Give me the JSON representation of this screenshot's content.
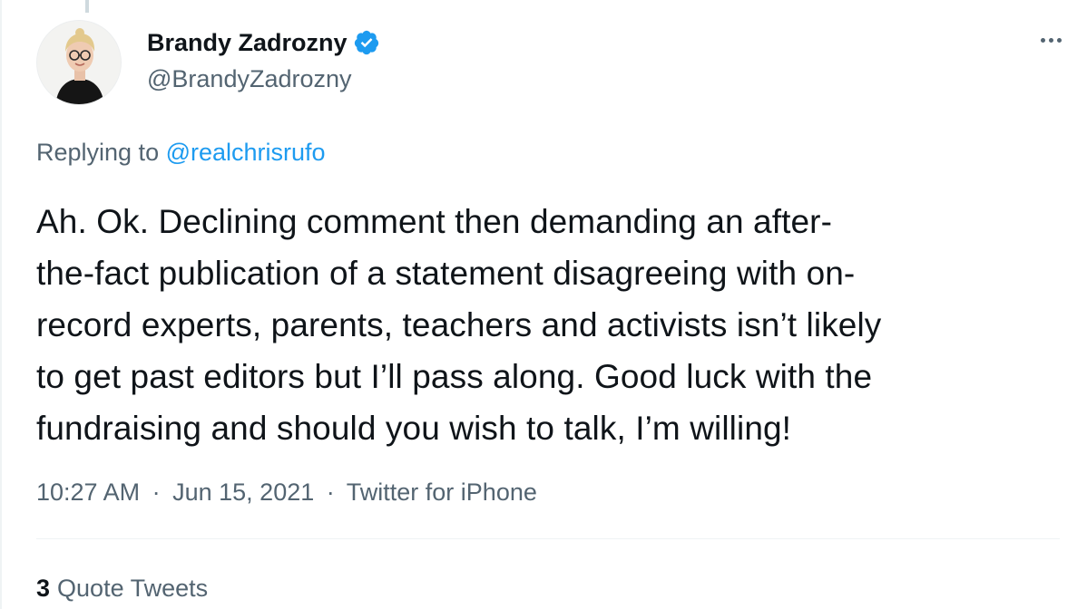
{
  "tweet": {
    "author": {
      "display_name": "Brandy Zadrozny",
      "handle": "@BrandyZadrozny",
      "verified": true,
      "avatar_icon": "profile-photo"
    },
    "more_icon": "more-horizontal-icon",
    "replying_to_prefix": "Replying to",
    "replying_to_handle": "@realchrisrufo",
    "text": "Ah. Ok. Declining comment then demanding an after-\nthe-fact publication of a statement disagreeing with on-\nrecord experts, parents, teachers and activists isn’t likely\nto get past editors but I’ll pass along. Good luck with the\nfundraising and should you wish to talk, I’m willing!",
    "time": "10:27 AM",
    "date": "Jun 15, 2021",
    "separator": "·",
    "source": "Twitter for iPhone",
    "quote_count": "3",
    "quote_label": "Quote Tweets"
  },
  "colors": {
    "accent": "#1d9bf0",
    "secondary_text": "#536471",
    "primary_text": "#0f1419"
  }
}
